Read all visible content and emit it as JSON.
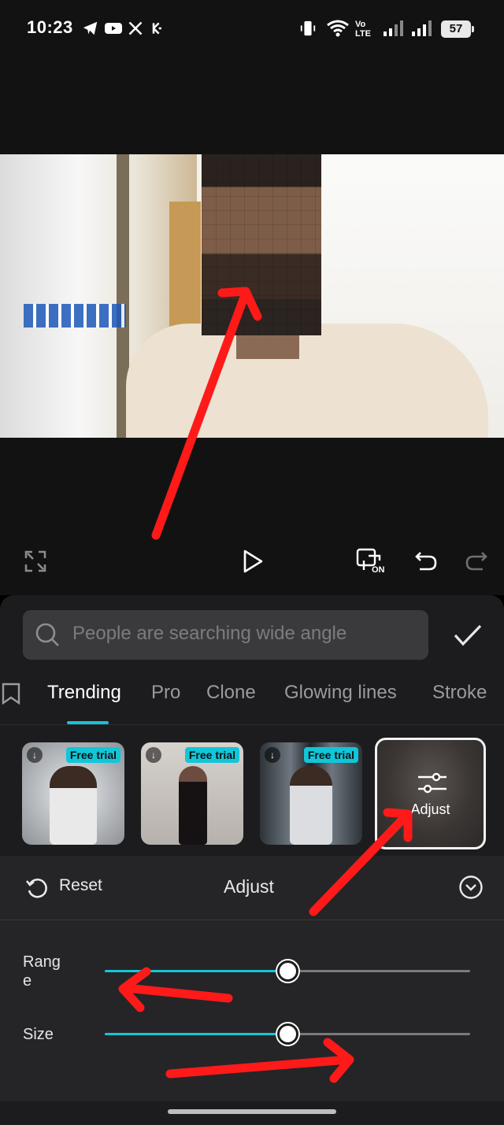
{
  "status_bar": {
    "time": "10:23",
    "network": "Vo LTE",
    "battery": "57",
    "icons": [
      "telegram-icon",
      "youtube-icon",
      "x-icon",
      "kucoin-icon",
      "vibrate-icon",
      "wifi-icon",
      "signal-icon",
      "signal-icon"
    ]
  },
  "player": {
    "controls": [
      "fullscreen-icon",
      "play-icon",
      "compare-on-icon",
      "undo-icon",
      "redo-icon"
    ],
    "compare_badge": "ON"
  },
  "search": {
    "placeholder": "People are searching wide angle"
  },
  "tabs": [
    {
      "label": "Trending",
      "active": true
    },
    {
      "label": "Pro",
      "active": false
    },
    {
      "label": "Clone",
      "active": false
    },
    {
      "label": "Glowing lines",
      "active": false
    },
    {
      "label": "Stroke",
      "active": false
    }
  ],
  "effects": [
    {
      "badge": "Free trial"
    },
    {
      "badge": "Free trial"
    },
    {
      "badge": "Free trial"
    },
    {
      "label": "Adjust",
      "selected": true
    }
  ],
  "adjust_panel": {
    "reset_label": "Reset",
    "title": "Adjust",
    "sliders": [
      {
        "label_line1": "Rang",
        "label_line2": "e",
        "value": 0.5
      },
      {
        "label": "Size",
        "value": 0.5
      }
    ]
  },
  "colors": {
    "accent": "#18c3d6",
    "annotation": "#ff1a1a",
    "panel": "#1c1c1e"
  }
}
